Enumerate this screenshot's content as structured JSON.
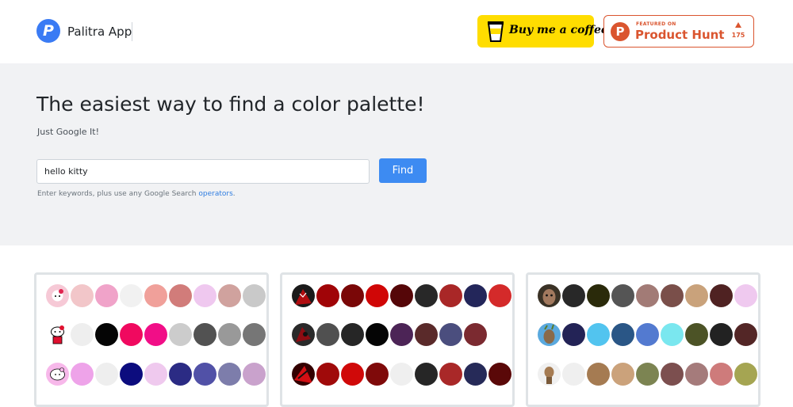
{
  "header": {
    "logo_letter": "P",
    "app_name": "Palitra App",
    "bmc_label": "Buy me a coffee",
    "ph_small": "FEATURED ON",
    "ph_big": "Product Hunt",
    "ph_count": "175"
  },
  "hero": {
    "title": "The easiest way to find a color palette!",
    "subtitle": "Just Google It!",
    "search_value": "hello kitty",
    "find_label": "Find",
    "hint_prefix": "Enter keywords, plus use any Google Search ",
    "hint_link": "operators",
    "hint_suffix": "."
  },
  "palettes": [
    {
      "rows": [
        {
          "thumb": "pink-kitty-thumb",
          "colors": [
            "#f2c6c9",
            "#f0a3c9",
            "#f1f1f1",
            "#f0a09a",
            "#d17c7a",
            "#efc8ef",
            "#d0a29e",
            "#c9c9c9"
          ]
        },
        {
          "thumb": "kitty-red-bow-thumb",
          "colors": [
            "#eeeeee",
            "#050505",
            "#f0095f",
            "#f10e87",
            "#cccccc",
            "#525252",
            "#999999",
            "#767676"
          ]
        },
        {
          "thumb": "kitty-outline-thumb",
          "colors": [
            "#eea3e9",
            "#eeeeee",
            "#0c0c7e",
            "#efc9ee",
            "#2b2b84",
            "#5151a7",
            "#7d7dab",
            "#c9a2cc"
          ]
        }
      ]
    },
    {
      "rows": [
        {
          "thumb": "spider-red-thumb",
          "colors": [
            "#a00407",
            "#7a0707",
            "#d00606",
            "#550608",
            "#282828",
            "#a92727",
            "#23265a",
            "#d42a2a"
          ]
        },
        {
          "thumb": "spider-dark-thumb",
          "colors": [
            "#505050",
            "#262626",
            "#050505",
            "#4c2456",
            "#5a2a2a",
            "#4b4e7e",
            "#7b2a30",
            "#ffffff"
          ]
        },
        {
          "thumb": "spider-action-thumb",
          "colors": [
            "#a00a0a",
            "#d00909",
            "#7f0a0a",
            "#efefef",
            "#262626",
            "#a92828",
            "#262a58",
            "#5a0808"
          ]
        }
      ]
    },
    {
      "rows": [
        {
          "thumb": "groot-face-thumb",
          "colors": [
            "#282828",
            "#2a2a0a",
            "#555555",
            "#a27b76",
            "#7a4f4a",
            "#c9a27b",
            "#4f2222",
            "#efc9ef"
          ]
        },
        {
          "thumb": "groot-blue-thumb",
          "colors": [
            "#232356",
            "#52c4ef",
            "#2a5686",
            "#537ad0",
            "#7ae7ef",
            "#4c5326",
            "#222222",
            "#532626"
          ]
        },
        {
          "thumb": "groot-baby-thumb",
          "colors": [
            "#efefef",
            "#a57b52",
            "#cba27b",
            "#7c8452",
            "#7c4f4f",
            "#a57b7b",
            "#ce7b7b",
            "#a5a552"
          ]
        }
      ]
    }
  ],
  "colors": {
    "accent": "#3d8bf2",
    "bmc_yellow": "#ffdd00",
    "ph_orange": "#da552f",
    "hero_bg": "#f1f2f4"
  }
}
